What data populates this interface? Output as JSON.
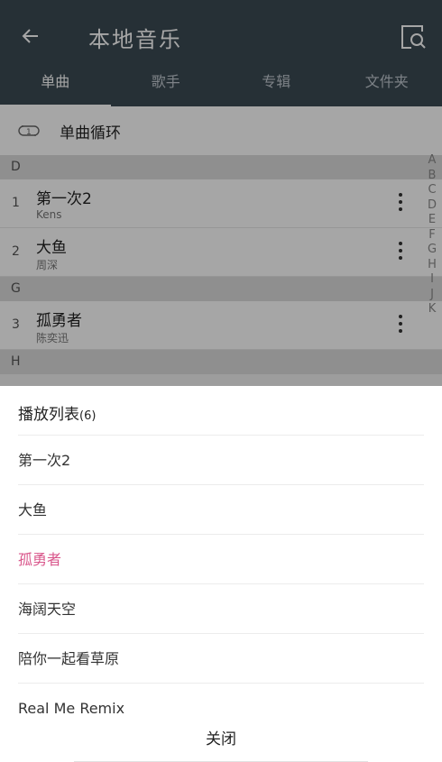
{
  "header": {
    "title": "本地音乐",
    "tabs": [
      "单曲",
      "歌手",
      "专辑",
      "文件夹"
    ],
    "active_tab": "单曲"
  },
  "loop_mode": {
    "label": "单曲循环",
    "icon": "repeat-one-icon"
  },
  "sections": [
    {
      "letter": "D",
      "songs": [
        {
          "num": "1",
          "name": "第一次2",
          "artist": "Kens"
        },
        {
          "num": "2",
          "name": "大鱼",
          "artist": "周深"
        }
      ]
    },
    {
      "letter": "G",
      "songs": [
        {
          "num": "3",
          "name": "孤勇者",
          "artist": "陈奕迅"
        }
      ]
    },
    {
      "letter": "H",
      "songs": []
    }
  ],
  "index_letters": [
    "A",
    "B",
    "C",
    "D",
    "E",
    "F",
    "G",
    "H",
    "I",
    "J",
    "K"
  ],
  "playlist": {
    "title": "播放列表",
    "count": "(6)",
    "items": [
      "第一次2",
      "大鱼",
      "孤勇者",
      "海阔天空",
      "陪你一起看草原",
      "Real Me Remix"
    ],
    "playing_index": 2,
    "close_label": "关闭"
  },
  "colors": {
    "header_bg": "#3b4a54",
    "playing": "#d9568b"
  }
}
